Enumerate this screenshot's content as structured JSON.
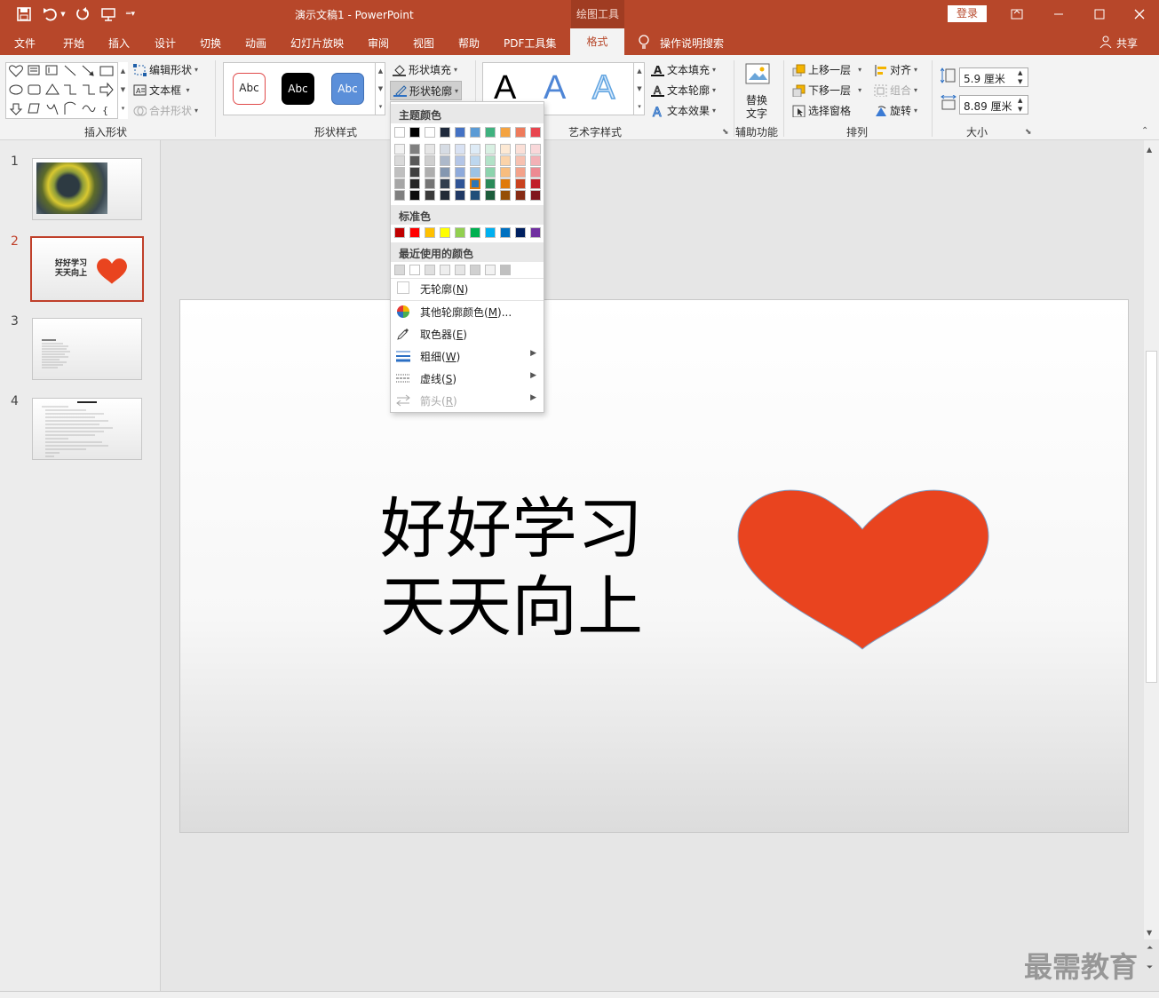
{
  "titlebar": {
    "doc_title": "演示文稿1 - PowerPoint",
    "context_tab": "绘图工具",
    "login": "登录"
  },
  "menu": {
    "items": [
      "文件",
      "开始",
      "插入",
      "设计",
      "切换",
      "动画",
      "幻灯片放映",
      "审阅",
      "视图",
      "帮助",
      "PDF工具集",
      "格式"
    ],
    "active": "格式",
    "search": "操作说明搜索",
    "share": "共享"
  },
  "ribbon": {
    "insert_shapes": {
      "label": "插入形状",
      "edit_shape": "编辑形状",
      "textbox": "文本框",
      "merge": "合并形状"
    },
    "shape_styles": {
      "label": "形状样式",
      "abc": "Abc",
      "fill": "形状填充",
      "outline": "形状轮廓"
    },
    "wordart": {
      "label": "艺术字样式",
      "letter": "A",
      "text_fill": "文本填充",
      "text_outline": "文本轮廓",
      "text_effect": "文本效果"
    },
    "accessibility": {
      "label": "辅助功能",
      "alt_text_1": "替换",
      "alt_text_2": "文字"
    },
    "arrange": {
      "label": "排列",
      "bring_forward": "上移一层",
      "send_backward": "下移一层",
      "selection_pane": "选择窗格",
      "align": "对齐",
      "group": "组合",
      "rotate": "旋转"
    },
    "size": {
      "label": "大小",
      "height": "5.9 厘米",
      "width": "8.89 厘米"
    }
  },
  "thumbnails": [
    "1",
    "2",
    "3",
    "4"
  ],
  "slide": {
    "line1": "好好学习",
    "line2": "天天向上",
    "thumb_line1": "好好学习",
    "thumb_line2": "天天向上"
  },
  "dropdown": {
    "theme_colors": "主题颜色",
    "standard_colors": "标准色",
    "recent_colors": "最近使用的颜色",
    "no_outline": "无轮廓(",
    "no_outline_key": "N",
    "more_colors": "其他轮廓颜色(",
    "more_colors_key": "M",
    "eyedropper": "取色器(",
    "eyedropper_key": "E",
    "weight": "粗细(",
    "weight_key": "W",
    "dashes": "虚线(",
    "dashes_key": "S",
    "arrows": "箭头(",
    "arrows_key": "R",
    "close_paren": ")",
    "more_suffix": ")..."
  },
  "watermark": "最需教育",
  "colors": {
    "accent": "#b7472a",
    "heart": "#e9441f"
  }
}
